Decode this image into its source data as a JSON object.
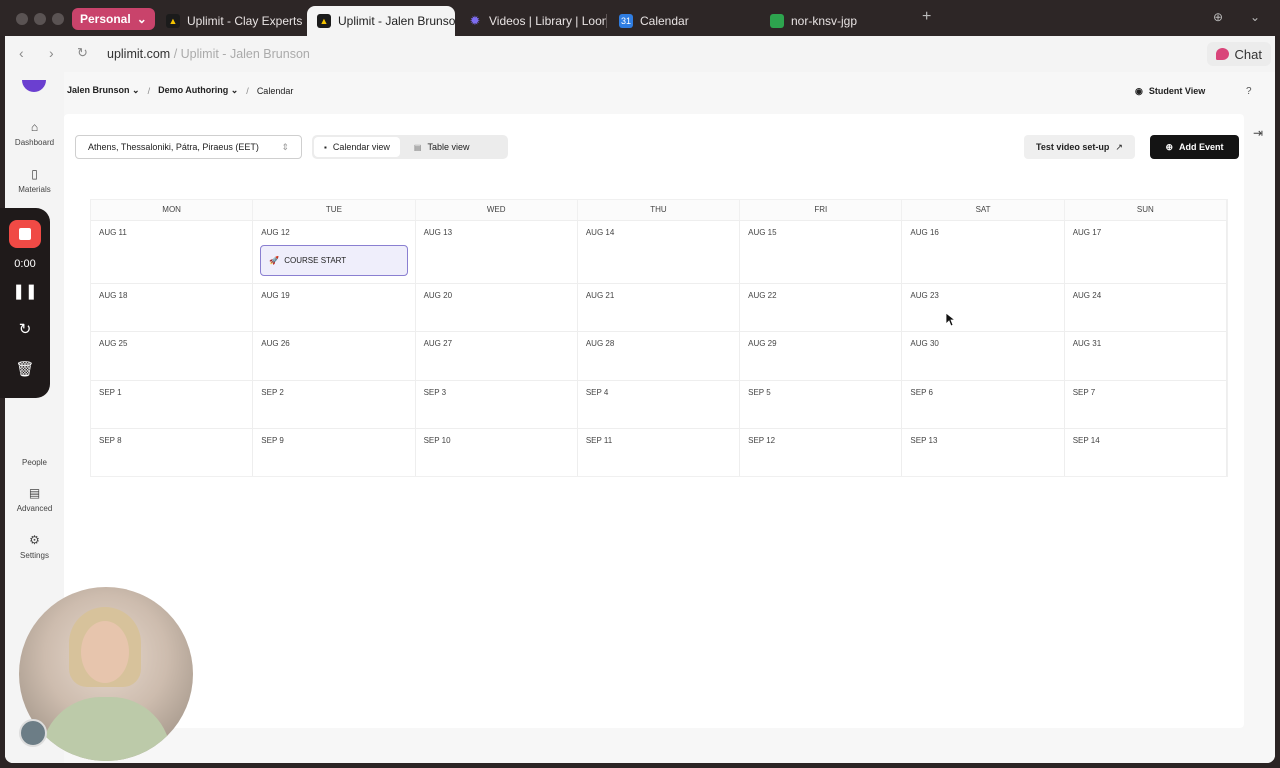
{
  "browser": {
    "profile_label": "Personal",
    "tabs": [
      {
        "label": "Uplimit - Clay Experts B",
        "active": false
      },
      {
        "label": "Uplimit - Jalen Brunson",
        "active": true
      },
      {
        "label": "Videos | Library | Loom",
        "active": false
      },
      {
        "label": "Calendar",
        "active": false
      },
      {
        "label": "nor-knsv-jgp",
        "active": false
      }
    ],
    "new_tab": "+",
    "url_host": "uplimit.com",
    "url_rest": " / Uplimit - Jalen Brunson",
    "chat_label": "Chat"
  },
  "sidebar": {
    "items": [
      {
        "label": "Dashboard",
        "icon": "rocket-icon"
      },
      {
        "label": "Materials",
        "icon": "book-icon"
      },
      {
        "label": "People",
        "icon": "people-icon"
      },
      {
        "label": "Advanced",
        "icon": "advanced-icon"
      },
      {
        "label": "Settings",
        "icon": "gear-icon"
      }
    ]
  },
  "breadcrumb": {
    "items": [
      "Jalen Brunson",
      "Demo Authoring",
      "Calendar"
    ],
    "separator": "/"
  },
  "header": {
    "student_view_label": "Student View",
    "help_label": "?"
  },
  "toolbar": {
    "timezone": "Athens, Thessaloniki, Pátra, Piraeus (EET)",
    "calendar_view_label": "Calendar view",
    "table_view_label": "Table view",
    "test_video_label": "Test video set-up",
    "add_event_label": "Add Event"
  },
  "calendar": {
    "weekdays": [
      "MON",
      "TUE",
      "WED",
      "THU",
      "FRI",
      "SAT",
      "SUN"
    ],
    "weeks": [
      [
        "AUG 11",
        "AUG 12",
        "AUG 13",
        "AUG 14",
        "AUG 15",
        "AUG 16",
        "AUG 17"
      ],
      [
        "AUG 18",
        "AUG 19",
        "AUG 20",
        "AUG 21",
        "AUG 22",
        "AUG 23",
        "AUG 24"
      ],
      [
        "AUG 25",
        "AUG 26",
        "AUG 27",
        "AUG 28",
        "AUG 29",
        "AUG 30",
        "AUG 31"
      ],
      [
        "SEP 1",
        "SEP 2",
        "SEP 3",
        "SEP 4",
        "SEP 5",
        "SEP 6",
        "SEP 7"
      ],
      [
        "SEP 8",
        "SEP 9",
        "SEP 10",
        "SEP 11",
        "SEP 12",
        "SEP 13",
        "SEP 14"
      ]
    ],
    "event": {
      "label": "COURSE START",
      "icon": "rocket-icon",
      "day": "AUG 12"
    }
  },
  "recorder": {
    "time": "0:00"
  },
  "colors": {
    "accent": "#c9436b",
    "record": "#f04a45",
    "event_border": "#8a7fd1",
    "event_bg": "#efeefb",
    "primary_button": "#141414"
  }
}
